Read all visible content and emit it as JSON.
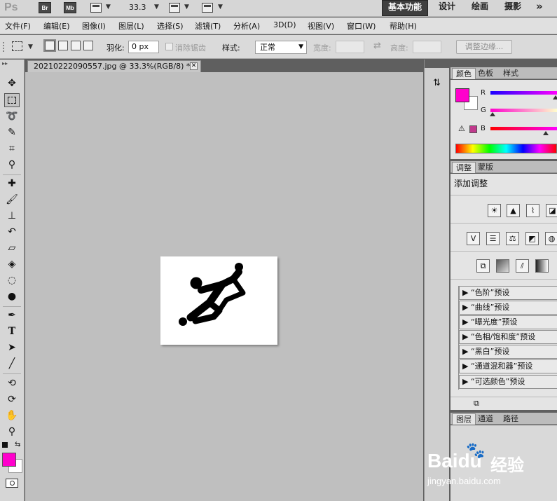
{
  "appbar": {
    "logo": "Ps",
    "bridge_label": "Br",
    "minibridge_label": "Mb",
    "zoom": "33.3",
    "workspaces": [
      "基本功能",
      "设计",
      "绘画",
      "摄影"
    ],
    "more": "»"
  },
  "menu": [
    "文件(F)",
    "编辑(E)",
    "图像(I)",
    "图层(L)",
    "选择(S)",
    "滤镜(T)",
    "分析(A)",
    "3D(D)",
    "视图(V)",
    "窗口(W)",
    "帮助(H)"
  ],
  "options": {
    "feather_label": "羽化:",
    "feather_value": "0 px",
    "antialias_label": "消除锯齿",
    "style_label": "样式:",
    "style_value": "正常",
    "width_label": "宽度:",
    "height_label": "高度:",
    "refine_label": "调整边缘..."
  },
  "document": {
    "tab_title": "20210222090557.jpg @ 33.3%(RGB/8) *",
    "close_glyph": "✕"
  },
  "color_panel": {
    "tabs": [
      "颜色",
      "色板",
      "样式"
    ],
    "r_label": "R",
    "g_label": "G",
    "b_label": "B",
    "foreground": "#ff00cc",
    "background": "#ffffff"
  },
  "adjust_panel": {
    "tabs": [
      "调整",
      "蒙版"
    ],
    "title": "添加调整",
    "presets": [
      "“色阶”预设",
      "“曲线”预设",
      "“曝光度”预设",
      "“色相/饱和度”预设",
      "“黑白”预设",
      "“通道混和器”预设",
      "“可选颜色”预设"
    ]
  },
  "layers_panel": {
    "tabs": [
      "图层",
      "通道",
      "路径"
    ]
  },
  "watermark": {
    "brand": "Baidu",
    "brand_cn": "经验",
    "url": "jingyan.baidu.com"
  }
}
